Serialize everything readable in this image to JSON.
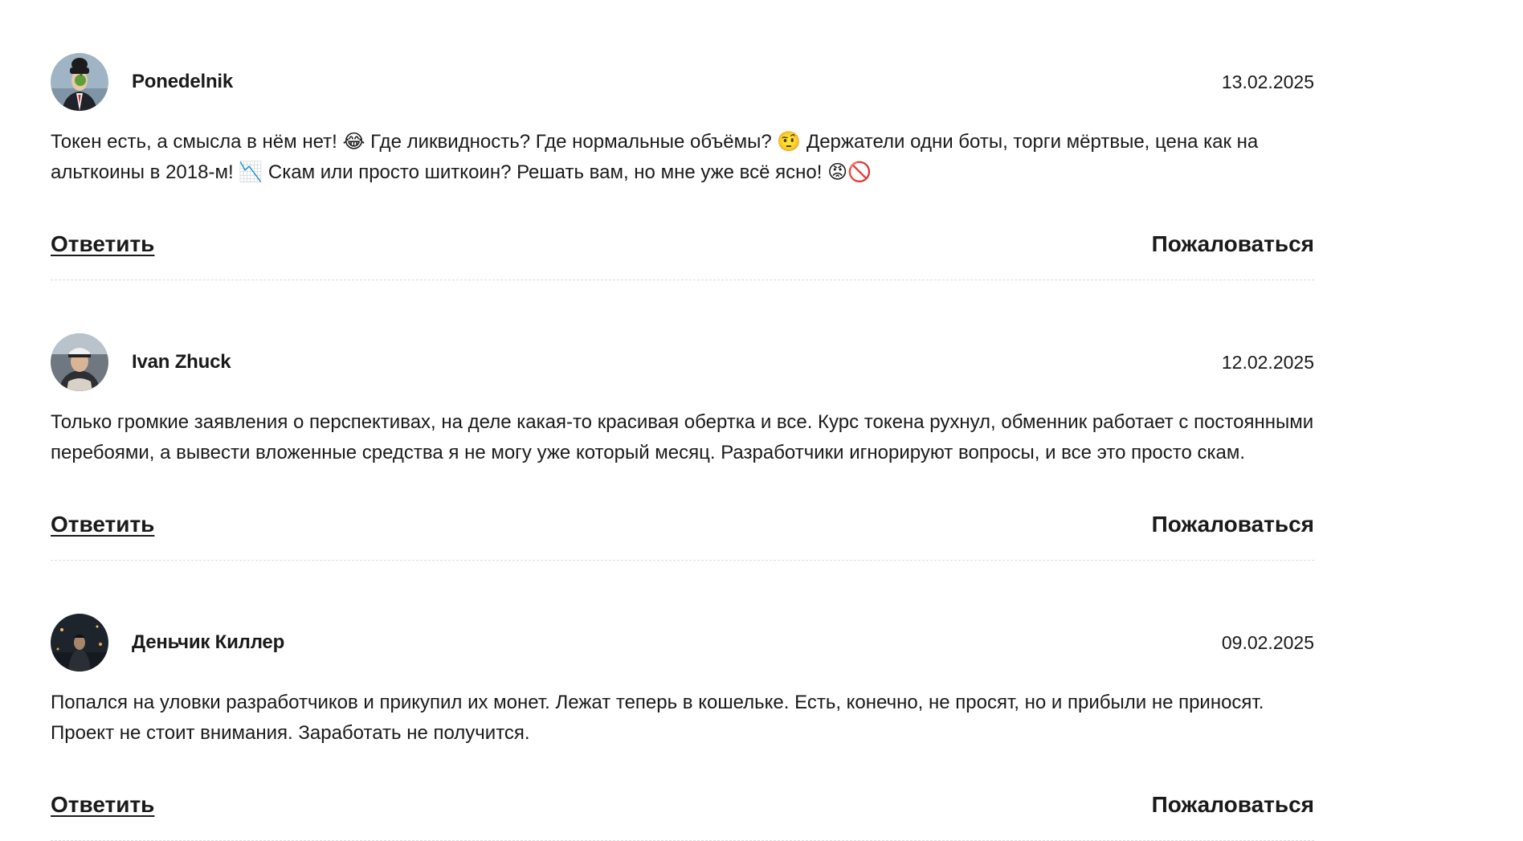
{
  "comments": [
    {
      "author": "Ponedelnik",
      "date": "13.02.2025",
      "text": "Токен есть, а смысла в нём нет! 😂 Где ликвидность? Где нормальные объёмы? 🤨 Держатели одни боты, торги мёртвые, цена как на альткоины в 2018-м! 📉 Скам или просто шиткоин? Решать вам, но мне уже всё ясно! 😡🚫",
      "reply_label": "Ответить",
      "complain_label": "Пожаловаться"
    },
    {
      "author": "Ivan Zhuck",
      "date": "12.02.2025",
      "text": "Только громкие заявления о перспективах, на деле какая-то красивая обертка и все. Курс токена рухнул, обменник работает с постоянными перебоями, а вывести вложенные средства я не могу уже который месяц. Разработчики игнорируют вопросы, и все это просто скам.",
      "reply_label": "Ответить",
      "complain_label": "Пожаловаться"
    },
    {
      "author": "Деньчик Киллер",
      "date": "09.02.2025",
      "text": "Попался на уловки разработчиков и прикупил их монет. Лежат теперь в кошельке. Есть, конечно, не просят, но и прибыли не приносят. Проект не стоит внимания. Заработать не получится.",
      "reply_label": "Ответить",
      "complain_label": "Пожаловаться"
    }
  ]
}
